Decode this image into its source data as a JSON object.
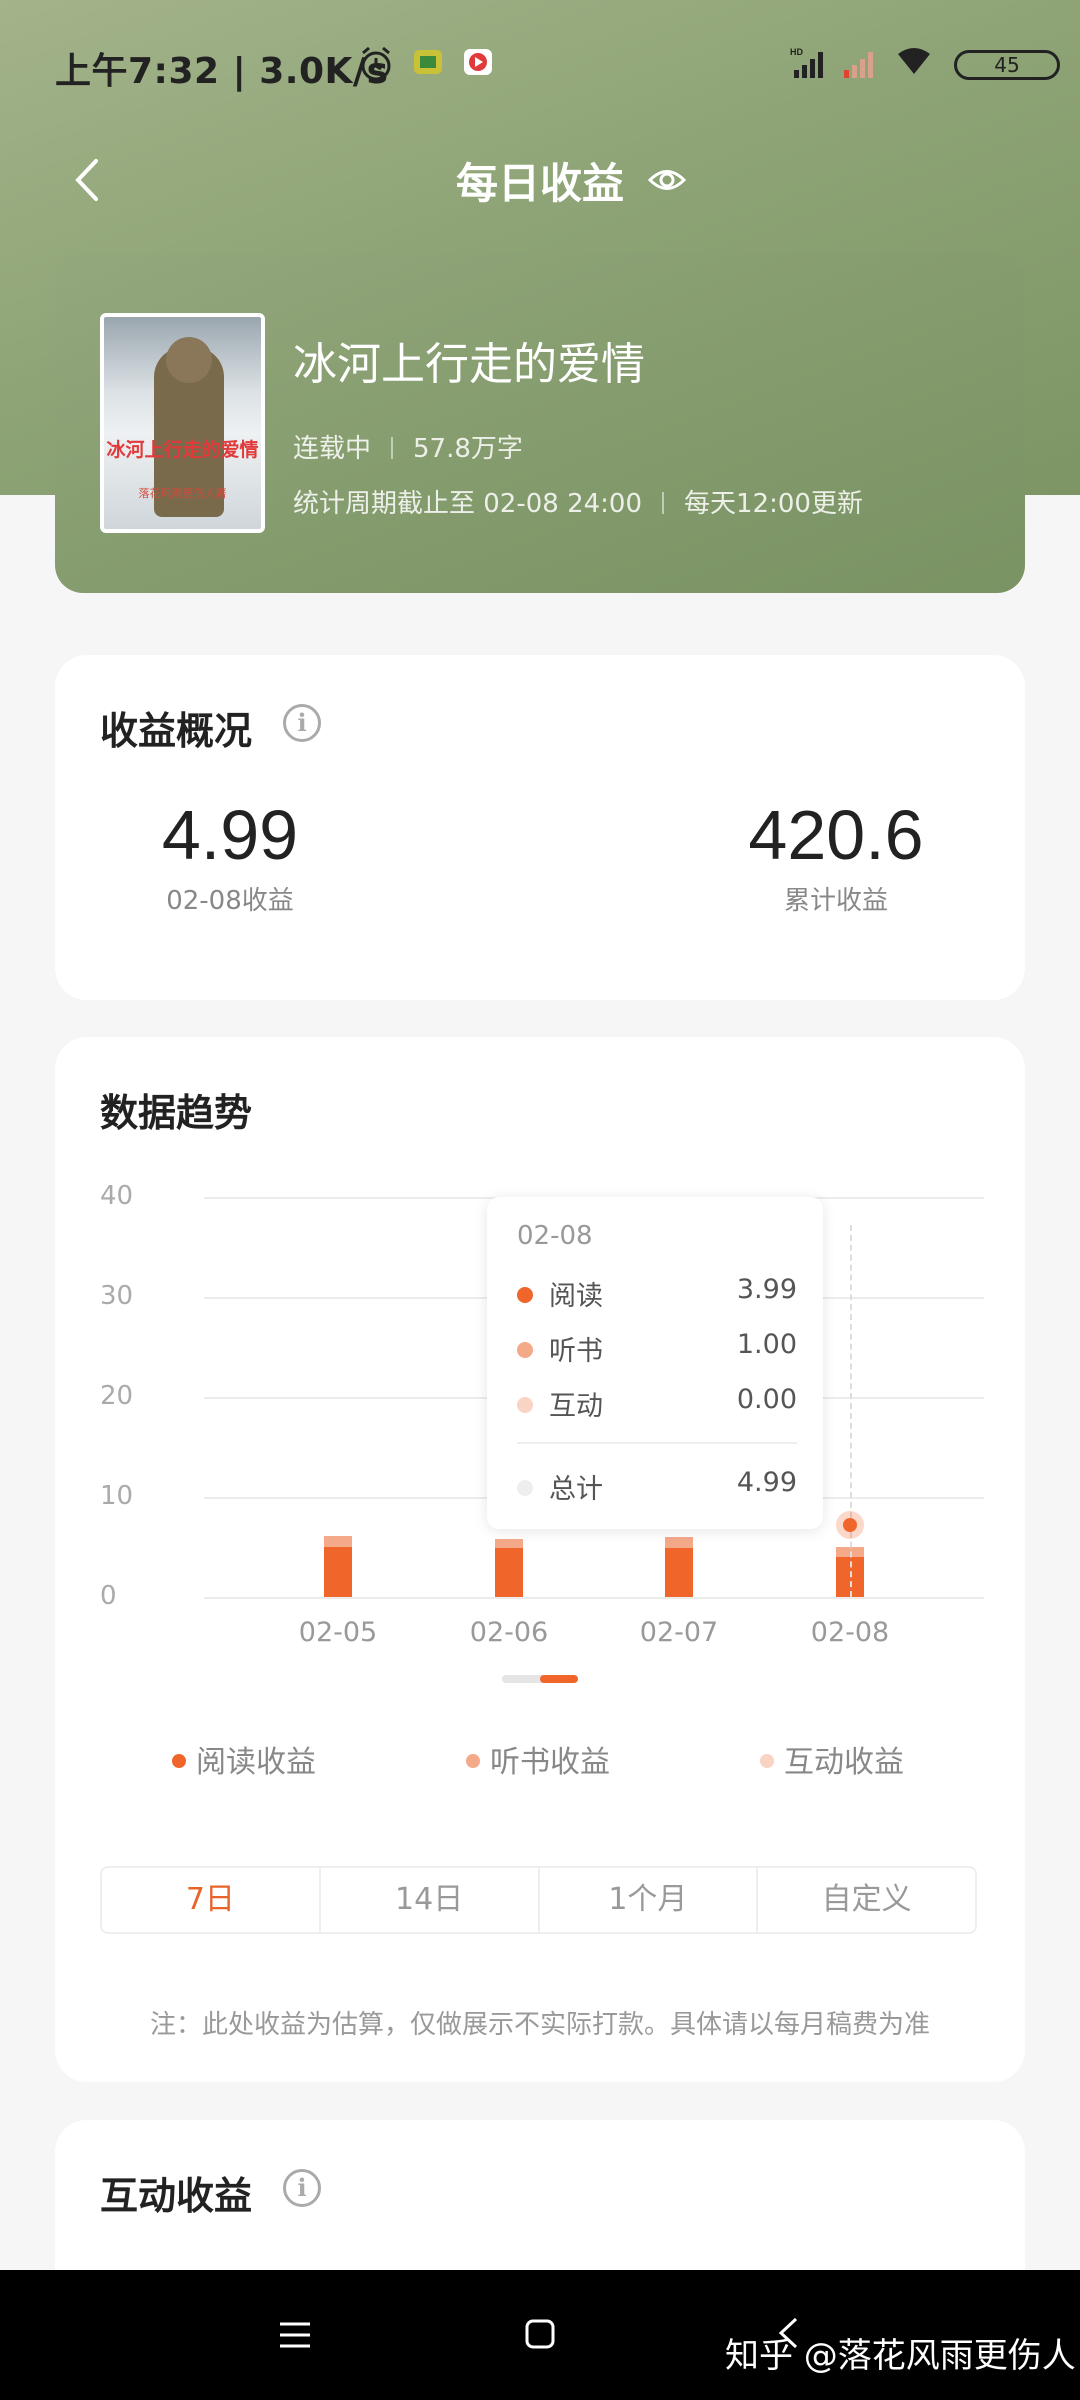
{
  "status_bar": {
    "time": "上午7:32 | 3.0K/s",
    "battery": "45"
  },
  "header": {
    "title": "每日收益"
  },
  "book": {
    "title": "冰河上行走的爱情",
    "cover_title": "冰河上行走的爱情",
    "cover_subtitle": "落花风雨更伤人著",
    "status": "连载中",
    "words": "57.8万字",
    "period": "统计周期截止至 02-08 24:00",
    "update": "每天12:00更新"
  },
  "overview": {
    "title": "收益概况",
    "daily_value": "4.99",
    "daily_label": "02-08收益",
    "total_value": "420.6",
    "total_label": "累计收益"
  },
  "trend": {
    "title": "数据趋势",
    "tooltip": {
      "date": "02-08",
      "rows": [
        {
          "label": "阅读",
          "value": "3.99"
        },
        {
          "label": "听书",
          "value": "1.00"
        },
        {
          "label": "互动",
          "value": "0.00"
        }
      ],
      "total_label": "总计",
      "total_value": "4.99"
    },
    "legend": [
      "阅读收益",
      "听书收益",
      "互动收益"
    ],
    "ranges": [
      "7日",
      "14日",
      "1个月",
      "自定义"
    ],
    "active_range": "7日",
    "note": "注：此处收益为估算，仅做展示不实际打款。具体请以每月稿费为准"
  },
  "chart_data": {
    "type": "bar",
    "stacked": true,
    "categories": [
      "02-05",
      "02-06",
      "02-07",
      "02-08"
    ],
    "series": [
      {
        "name": "阅读收益",
        "color": "#f0652a",
        "values": [
          5.0,
          4.9,
          4.9,
          3.99
        ]
      },
      {
        "name": "听书收益",
        "color": "#f4a989",
        "values": [
          1.1,
          0.9,
          1.1,
          1.0
        ]
      },
      {
        "name": "互动收益",
        "color": "#f9d3c3",
        "values": [
          0,
          0,
          0,
          0
        ]
      }
    ],
    "ylim": [
      0,
      40
    ],
    "yticks": [
      "0",
      "10",
      "20",
      "30",
      "40"
    ],
    "grid": true,
    "legend": "bottom"
  },
  "interactive": {
    "title": "互动收益"
  },
  "watermark": "知乎 @落花风雨更伤人"
}
